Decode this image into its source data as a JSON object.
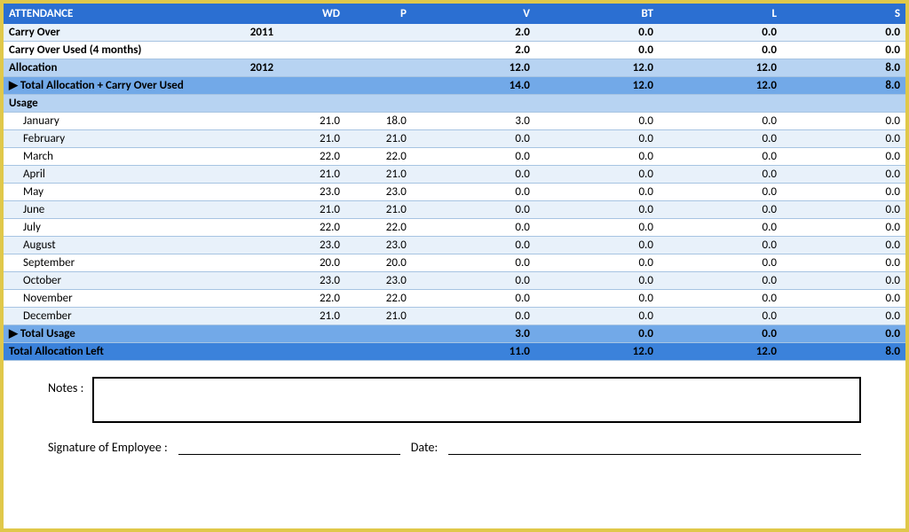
{
  "header": {
    "title": "ATTENDANCE",
    "wd": "WD",
    "p": "P",
    "v": "V",
    "bt": "BT",
    "l": "L",
    "s": "S"
  },
  "rows": {
    "carry_over": {
      "label": "Carry Over",
      "year": "2011",
      "wd": "",
      "p": "",
      "v": "2.0",
      "bt": "0.0",
      "l": "0.0",
      "s": "0.0"
    },
    "carry_over_used": {
      "label": "Carry Over Used (4 months)",
      "year": "",
      "wd": "",
      "p": "",
      "v": "2.0",
      "bt": "0.0",
      "l": "0.0",
      "s": "0.0"
    },
    "allocation": {
      "label": "Allocation",
      "year": "2012",
      "wd": "",
      "p": "",
      "v": "12.0",
      "bt": "12.0",
      "l": "12.0",
      "s": "8.0"
    },
    "total_alloc": {
      "label": "▶ Total Allocation + Carry Over Used",
      "v": "14.0",
      "bt": "12.0",
      "l": "12.0",
      "s": "8.0"
    },
    "usage_hdr": {
      "label": "Usage"
    },
    "months": [
      {
        "label": "January",
        "wd": "21.0",
        "p": "18.0",
        "v": "3.0",
        "bt": "0.0",
        "l": "0.0",
        "s": "0.0"
      },
      {
        "label": "February",
        "wd": "21.0",
        "p": "21.0",
        "v": "0.0",
        "bt": "0.0",
        "l": "0.0",
        "s": "0.0"
      },
      {
        "label": "March",
        "wd": "22.0",
        "p": "22.0",
        "v": "0.0",
        "bt": "0.0",
        "l": "0.0",
        "s": "0.0"
      },
      {
        "label": "April",
        "wd": "21.0",
        "p": "21.0",
        "v": "0.0",
        "bt": "0.0",
        "l": "0.0",
        "s": "0.0"
      },
      {
        "label": "May",
        "wd": "23.0",
        "p": "23.0",
        "v": "0.0",
        "bt": "0.0",
        "l": "0.0",
        "s": "0.0"
      },
      {
        "label": "June",
        "wd": "21.0",
        "p": "21.0",
        "v": "0.0",
        "bt": "0.0",
        "l": "0.0",
        "s": "0.0"
      },
      {
        "label": "July",
        "wd": "22.0",
        "p": "22.0",
        "v": "0.0",
        "bt": "0.0",
        "l": "0.0",
        "s": "0.0"
      },
      {
        "label": "August",
        "wd": "23.0",
        "p": "23.0",
        "v": "0.0",
        "bt": "0.0",
        "l": "0.0",
        "s": "0.0"
      },
      {
        "label": "September",
        "wd": "20.0",
        "p": "20.0",
        "v": "0.0",
        "bt": "0.0",
        "l": "0.0",
        "s": "0.0"
      },
      {
        "label": "October",
        "wd": "23.0",
        "p": "23.0",
        "v": "0.0",
        "bt": "0.0",
        "l": "0.0",
        "s": "0.0"
      },
      {
        "label": "November",
        "wd": "22.0",
        "p": "22.0",
        "v": "0.0",
        "bt": "0.0",
        "l": "0.0",
        "s": "0.0"
      },
      {
        "label": "December",
        "wd": "21.0",
        "p": "21.0",
        "v": "0.0",
        "bt": "0.0",
        "l": "0.0",
        "s": "0.0"
      }
    ],
    "total_usage": {
      "label": "▶ Total Usage",
      "v": "3.0",
      "bt": "0.0",
      "l": "0.0",
      "s": "0.0"
    },
    "total_left": {
      "label": "Total Allocation Left",
      "v": "11.0",
      "bt": "12.0",
      "l": "12.0",
      "s": "8.0"
    }
  },
  "footer": {
    "notes_label": "Notes :",
    "sig_label": "Signature of Employee :",
    "date_label": "Date:"
  }
}
